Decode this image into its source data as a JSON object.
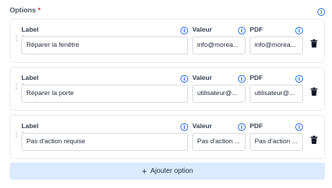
{
  "header": {
    "title": "Options",
    "required_mark": "*"
  },
  "columns": {
    "label": "Label",
    "valeur": "Valeur",
    "pdf": "PDF"
  },
  "options": [
    {
      "label": "Réparer la fenêtre",
      "valeur": "info@morea...",
      "pdf": "info@morea..."
    },
    {
      "label": "Réparer la porte",
      "valeur": "utilisateur@...",
      "pdf": "utilisateur@..."
    },
    {
      "label": "Pas d'action requise",
      "valeur": "Pas d'action ...",
      "pdf": "Pas d'action ..."
    }
  ],
  "add_button": {
    "label": "Ajouter option"
  },
  "icons": {
    "info": "info-icon",
    "drag": "drag-handle-icon",
    "delete": "trash-icon",
    "add": "plus-icon"
  },
  "colors": {
    "accent": "#2563eb",
    "required": "#dc2626",
    "add_button_bg": "#dbeafe"
  }
}
